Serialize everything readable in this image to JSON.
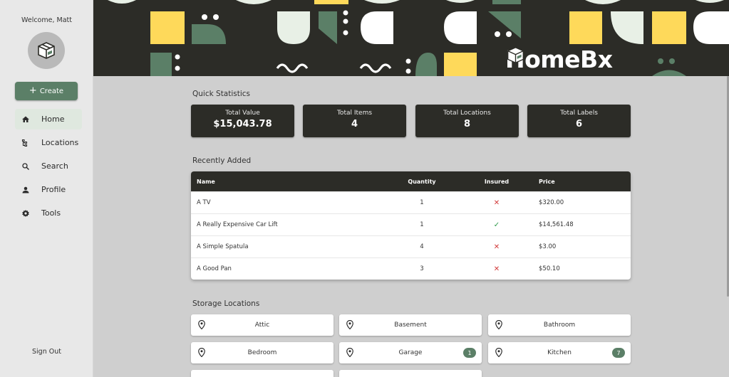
{
  "sidebar": {
    "welcome": "Welcome, Matt",
    "avatar_icon": "box-icon",
    "create_label": "Create",
    "items": [
      {
        "label": "Home",
        "icon": "home-icon",
        "active": true
      },
      {
        "label": "Locations",
        "icon": "tree-icon",
        "active": false
      },
      {
        "label": "Search",
        "icon": "search-icon",
        "active": false
      },
      {
        "label": "Profile",
        "icon": "person-icon",
        "active": false
      },
      {
        "label": "Tools",
        "icon": "gear-icon",
        "active": false
      }
    ],
    "signout": "Sign Out"
  },
  "banner": {
    "brand_prefix": "HomeB",
    "brand_suffix": "x"
  },
  "main": {
    "quick_statistics_title": "Quick Statistics",
    "stats": [
      {
        "title": "Total Value",
        "value": "$15,043.78"
      },
      {
        "title": "Total Items",
        "value": "4"
      },
      {
        "title": "Total Locations",
        "value": "8"
      },
      {
        "title": "Total Labels",
        "value": "6"
      }
    ],
    "recently_added_title": "Recently Added",
    "table": {
      "headers": {
        "name": "Name",
        "quantity": "Quantity",
        "insured": "Insured",
        "price": "Price"
      },
      "rows": [
        {
          "name": "A TV",
          "quantity": "1",
          "insured": false,
          "price": "$320.00"
        },
        {
          "name": "A Really Expensive Car Lift",
          "quantity": "1",
          "insured": true,
          "price": "$14,561.48"
        },
        {
          "name": "A Simple Spatula",
          "quantity": "4",
          "insured": false,
          "price": "$3.00"
        },
        {
          "name": "A Good Pan",
          "quantity": "3",
          "insured": false,
          "price": "$50.10"
        }
      ]
    },
    "storage_locations_title": "Storage Locations",
    "locations": [
      {
        "name": "Attic",
        "count": ""
      },
      {
        "name": "Basement",
        "count": ""
      },
      {
        "name": "Bathroom",
        "count": ""
      },
      {
        "name": "Bedroom",
        "count": ""
      },
      {
        "name": "Garage",
        "count": "1"
      },
      {
        "name": "Kitchen",
        "count": "7"
      }
    ]
  },
  "colors": {
    "accent": "#5b7f67",
    "dark": "#2c2c27",
    "yellow": "#fed95a",
    "mint": "#e8f0e6",
    "insured_yes": "#2e9a4a",
    "insured_no": "#d23a3a"
  }
}
